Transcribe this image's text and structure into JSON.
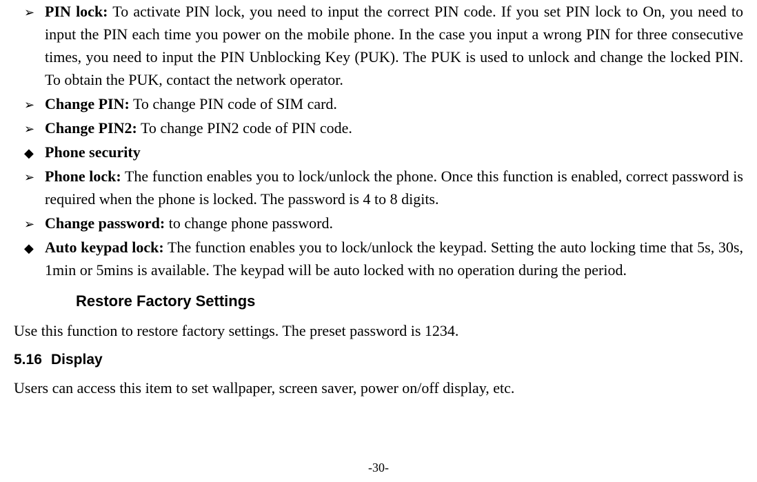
{
  "bullets": [
    {
      "type": "arrow",
      "term": "PIN lock:",
      "body": " To activate PIN lock, you need to input the correct PIN code. If you set PIN lock to On, you need to input the PIN each time you power on the mobile phone. In the case you input a wrong PIN for three consecutive times, you need to input the PIN Unblocking Key (PUK). The PUK is used to unlock and change the locked PIN. To obtain the PUK, contact the network operator."
    },
    {
      "type": "arrow",
      "term": "Change PIN:",
      "body": " To change PIN code of SIM card."
    },
    {
      "type": "arrow",
      "term": "Change PIN2:",
      "body": " To change PIN2 code of PIN code."
    },
    {
      "type": "diamond",
      "term": "Phone security",
      "body": ""
    },
    {
      "type": "arrow",
      "term": "Phone lock:",
      "body": " The function enables you to lock/unlock the phone. Once this function is enabled, correct password is required when the phone is locked. The password is 4 to 8 digits."
    },
    {
      "type": "arrow",
      "term": "Change password:",
      "body": " to change phone password."
    },
    {
      "type": "diamond",
      "term": "Auto keypad lock:",
      "body": " The function enables you to lock/unlock the keypad. Setting the auto locking time that 5s, 30s, 1min or 5mins is available. The keypad will be auto locked with no operation during the period."
    }
  ],
  "headings": {
    "restore": "Restore Factory Settings",
    "displayNumber": "5.16",
    "displayTitle": "Display"
  },
  "paragraphs": {
    "restore": "Use this function to restore factory settings. The preset password is 1234.",
    "display": "Users can access this item to set wallpaper, screen saver, power on/off display, etc."
  },
  "pageNumber": "-30-"
}
